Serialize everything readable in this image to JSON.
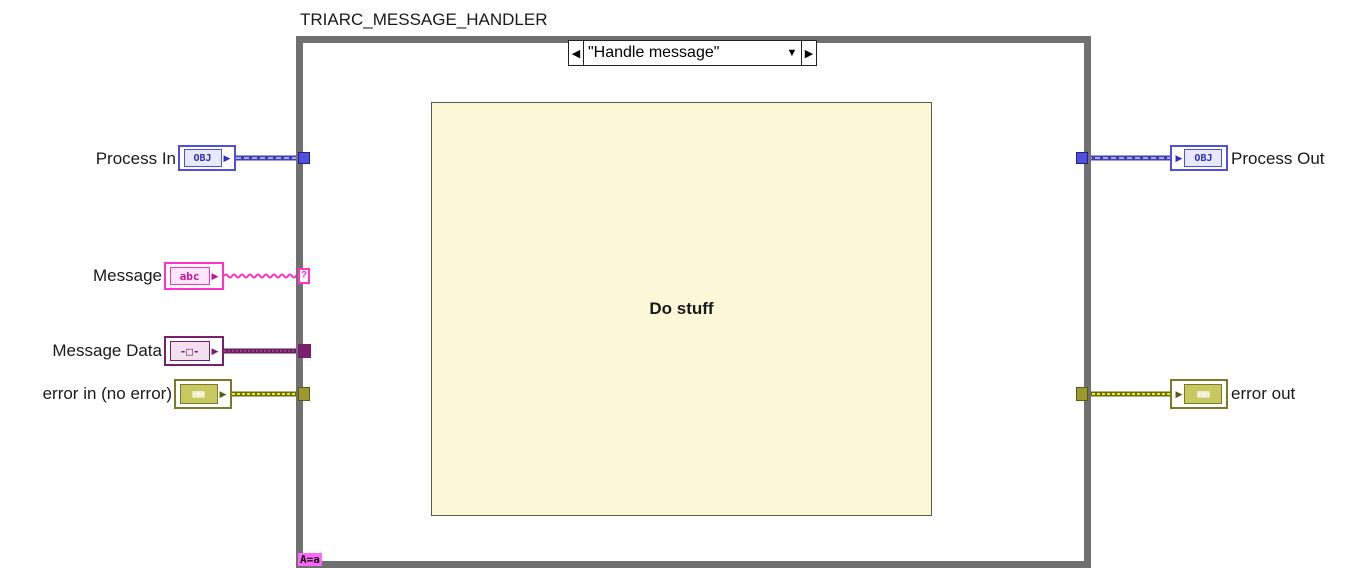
{
  "structure": {
    "name": "TRIARC_MESSAGE_HANDLER",
    "selector_value": "\"Handle message\"",
    "subdiagram_label": "Do stuff",
    "case_badge": "A=a"
  },
  "inputs": [
    {
      "label": "Process In",
      "glyph": "OBJ"
    },
    {
      "label": "Message",
      "glyph": "abc"
    },
    {
      "label": "Message Data",
      "glyph": "-□-"
    },
    {
      "label": "error in (no error)",
      "glyph": "▦▦"
    }
  ],
  "outputs": [
    {
      "label": "Process Out",
      "glyph": "OBJ"
    },
    {
      "label": "error out",
      "glyph": "▦▦"
    }
  ],
  "colors": {
    "object_wire": "#6b6bd6",
    "string_wire": "#ff33cc",
    "variant_wire": "#8a2a7a",
    "error_wire": "#c8c800",
    "error_term": "#7a7a2a",
    "frame": "#707070",
    "subdiagram_fill": "#fbf8d8"
  }
}
